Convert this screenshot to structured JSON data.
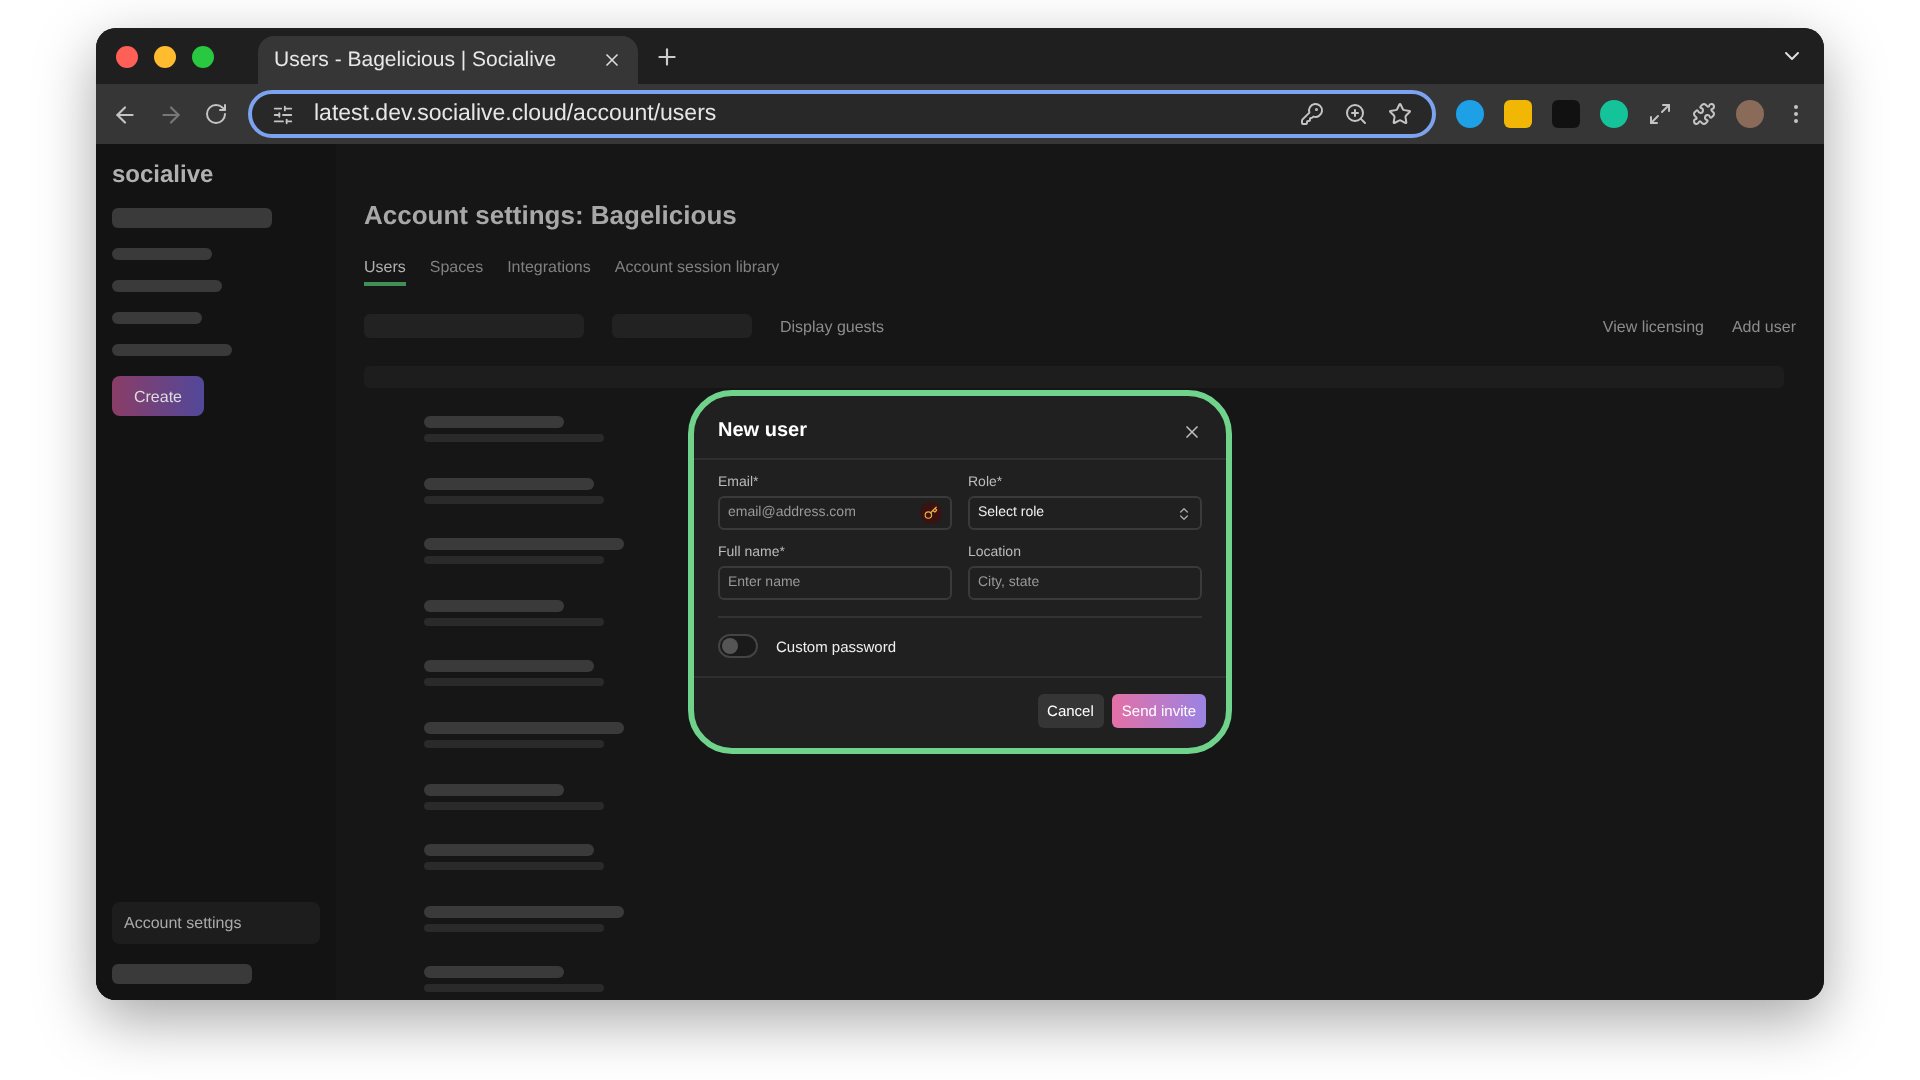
{
  "browser": {
    "tab_title": "Users - Bagelicious | Socialive",
    "url": "latest.dev.socialive.cloud/account/users"
  },
  "app": {
    "logo": "socialive",
    "heading": "Account settings: Bagelicious",
    "tabs": [
      {
        "label": "Users",
        "selected": true
      },
      {
        "label": "Spaces",
        "selected": false
      },
      {
        "label": "Integrations",
        "selected": false
      },
      {
        "label": "Account session library",
        "selected": false
      }
    ],
    "display_guests": "Display guests",
    "view_licensing": "View licensing",
    "add_user": "Add user",
    "create": "Create",
    "sidebar_footer": "Account settings"
  },
  "modal": {
    "title": "New user",
    "fields": [
      {
        "label": "Email*",
        "placeholder": "email@address.com",
        "kind": "email"
      },
      {
        "label": "Role*",
        "placeholder": "Select role",
        "kind": "select"
      },
      {
        "label": "Full name*",
        "placeholder": "Enter name",
        "kind": "text"
      },
      {
        "label": "Location",
        "placeholder": "City, state",
        "kind": "text"
      }
    ],
    "toggle": {
      "label": "Custom password",
      "on": false
    },
    "buttons": [
      {
        "label": "Cancel",
        "kind": "secondary"
      },
      {
        "label": "Send invite",
        "kind": "primary"
      }
    ]
  }
}
